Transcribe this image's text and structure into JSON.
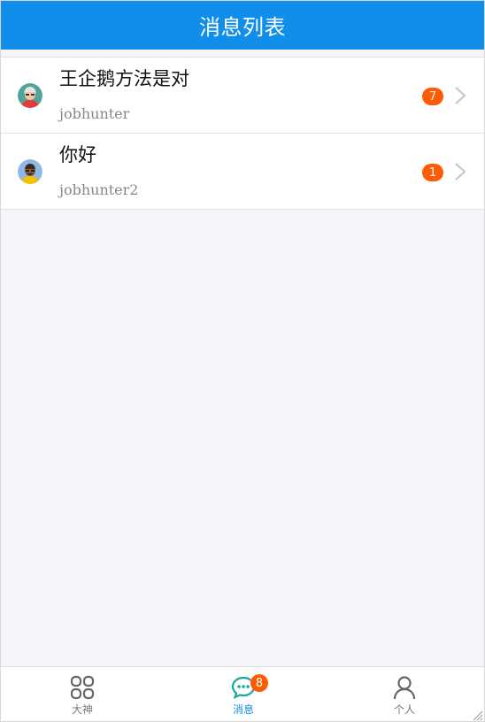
{
  "header": {
    "title": "消息列表"
  },
  "messages": [
    {
      "title": "王企鹅方法是对",
      "user": "jobhunter",
      "unread": "7"
    },
    {
      "title": "你好",
      "user": "jobhunter2",
      "unread": "1"
    }
  ],
  "tabbar": {
    "tabs": [
      {
        "label": "大神",
        "icon": "grid-icon",
        "active": false
      },
      {
        "label": "消息",
        "icon": "chat-bubble-icon",
        "active": true,
        "badge": "8"
      },
      {
        "label": "个人",
        "icon": "person-icon",
        "active": false
      }
    ]
  },
  "colors": {
    "primary": "#108ee9",
    "badge": "#ff5b05",
    "active_tab": "#108ee9",
    "background": "#f4f4f9"
  }
}
